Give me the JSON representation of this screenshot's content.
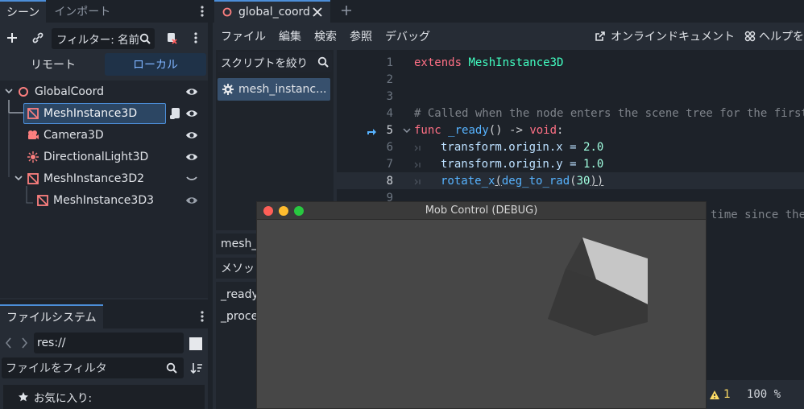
{
  "scene_panel": {
    "tabs": [
      "シーン",
      "インポート"
    ],
    "filter_placeholder": "フィルター: 名前",
    "mode_tabs": [
      "リモート",
      "ローカル"
    ],
    "tree": [
      {
        "label": "GlobalCoord"
      },
      {
        "label": "MeshInstance3D"
      },
      {
        "label": "Camera3D"
      },
      {
        "label": "DirectionalLight3D"
      },
      {
        "label": "MeshInstance3D2"
      },
      {
        "label": "MeshInstance3D3"
      }
    ]
  },
  "filesystem_panel": {
    "tab": "ファイルシステム",
    "path": "res://",
    "filter_placeholder": "ファイルをフィルタ",
    "favorites": "お気に入り:"
  },
  "editor": {
    "tab": "global_coord",
    "menu": [
      "ファイル",
      "編集",
      "検索",
      "参照",
      "デバッグ"
    ],
    "online_docs": "オンラインドキュメント",
    "help": "ヘルプを",
    "script_filter": "スクリプトを絞り",
    "script_item": "mesh_instanc...",
    "method_label": "mesh_i",
    "method_header": "メソッ",
    "methods": [
      "_ready",
      "_proce"
    ],
    "line_numbers": [
      "1",
      "2",
      "3",
      "4",
      "5",
      "6",
      "7",
      "8",
      "9"
    ],
    "code": {
      "l1_kw": "extends",
      "l1_type": "MeshInstance3D",
      "l4": "# Called when the node enters the scene tree for the first t",
      "l5_func": "func",
      "l5_name": "_ready",
      "l5_rest": "() -> ",
      "l5_void": "void",
      "l5_colon": ":",
      "l6_a": "transform",
      "l6_b": ".origin.x = ",
      "l6_num": "2.0",
      "l7_a": "transform",
      "l7_b": ".origin.y = ",
      "l7_num": "1.0",
      "l8_fn": "rotate_x",
      "l8_p1": "(",
      "l8_fn2": "deg_to_rad",
      "l8_p2": "(",
      "l8_num": "30",
      "l8_p3": "))",
      "l10_tail": "time since the"
    },
    "status_warnings": "1",
    "zoom": "100 %"
  },
  "game_window": {
    "title": "Mob Control (DEBUG)"
  },
  "colors": {
    "accent": "#4c8ed8",
    "keyword": "#ff7085",
    "type": "#42ffc2",
    "function": "#57b3ff"
  }
}
